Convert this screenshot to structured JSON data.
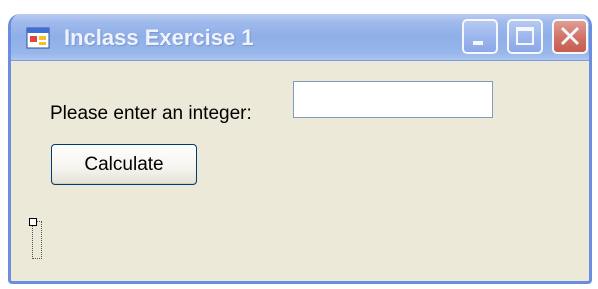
{
  "window": {
    "title": "Inclass Exercise 1",
    "icon": "form-icon",
    "controls": [
      "minimize-icon",
      "maximize-icon",
      "close-icon"
    ]
  },
  "form": {
    "prompt_label": "Please enter an integer:",
    "input_value": "",
    "calculate_label": "Calculate",
    "result_text": ""
  },
  "colors": {
    "title_bar": "#97b6ea",
    "window_body": "#ece9d8",
    "close_button": "#d96b57",
    "input_border": "#7f9db9",
    "button_border": "#003c74"
  }
}
